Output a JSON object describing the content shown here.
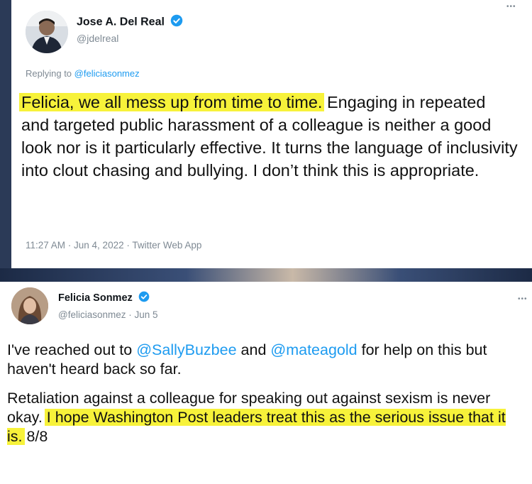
{
  "tweet1": {
    "name": "Jose A. Del Real",
    "handle": "@jdelreal",
    "more": "•••",
    "replying_prefix": "Replying to ",
    "replying_to": "@feliciasonmez",
    "highlight": "Felicia, we all mess up from time to time.",
    "body": " Engaging in repeated and targeted public harassment of a colleague is neither a good look nor is it particularly effective. It turns the language of inclusivity into clout chasing and bullying. I don’t think this is appropriate.",
    "timestamp": "11:27 AM · Jun 4, 2022 · Twitter Web App"
  },
  "tweet2": {
    "name": "Felicia Sonmez",
    "handle_date": "@feliciasonmez · Jun 5",
    "more": "•••",
    "p1_a": "I've reached out to ",
    "p1_mention1": "@SallyBuzbee",
    "p1_b": " and ",
    "p1_mention2": "@mateagold",
    "p1_c": " for help on this but haven't heard back so far.",
    "p2_a": "Retaliation against a colleague for speaking out against sexism is never okay. ",
    "p2_highlight": "I hope Washington Post leaders treat this as the serious issue that it is.",
    "p2_b": " 8/8"
  },
  "colors": {
    "highlight": "#f7f23a",
    "link": "#1d9bf0",
    "verified": "#1d9bf0",
    "muted": "#7f8a94"
  },
  "icons": {
    "verified": "verified-badge-icon",
    "more": "more-options-icon"
  }
}
